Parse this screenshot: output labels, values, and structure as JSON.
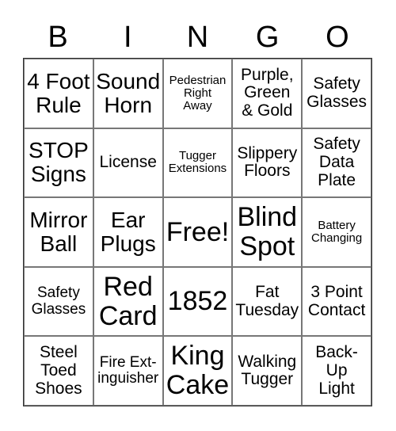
{
  "header": {
    "letters": [
      "B",
      "I",
      "N",
      "G",
      "O"
    ]
  },
  "cells": [
    {
      "text": "4 Foot\nRule",
      "size": "s-l"
    },
    {
      "text": "Sound\nHorn",
      "size": "s-l"
    },
    {
      "text": "Pedestrian\nRight\nAway",
      "size": "s-xs"
    },
    {
      "text": "Purple,\nGreen\n& Gold",
      "size": "s-m"
    },
    {
      "text": "Safety\nGlasses",
      "size": "s-m"
    },
    {
      "text": "STOP\nSigns",
      "size": "s-l"
    },
    {
      "text": "License",
      "size": "s-m"
    },
    {
      "text": "Tugger\nExtensions",
      "size": "s-xs"
    },
    {
      "text": "Slippery\nFloors",
      "size": "s-m"
    },
    {
      "text": "Safety\nData\nPlate",
      "size": "s-m"
    },
    {
      "text": "Mirror\nBall",
      "size": "s-l"
    },
    {
      "text": "Ear\nPlugs",
      "size": "s-l"
    },
    {
      "text": "Free!",
      "size": "s-xl"
    },
    {
      "text": "Blind\nSpot",
      "size": "s-xl"
    },
    {
      "text": "Battery\nChanging",
      "size": "s-xs"
    },
    {
      "text": "Safety\nGlasses",
      "size": "s-s"
    },
    {
      "text": "Red\nCard",
      "size": "s-xl"
    },
    {
      "text": "1852",
      "size": "s-xl"
    },
    {
      "text": "Fat\nTuesday",
      "size": "s-m"
    },
    {
      "text": "3 Point\nContact",
      "size": "s-m"
    },
    {
      "text": "Steel\nToed\nShoes",
      "size": "s-m"
    },
    {
      "text": "Fire Ext-\ninguisher",
      "size": "s-s"
    },
    {
      "text": "King\nCake",
      "size": "s-xl"
    },
    {
      "text": "Walking\nTugger",
      "size": "s-m"
    },
    {
      "text": "Back-\nUp\nLight",
      "size": "s-m"
    }
  ]
}
